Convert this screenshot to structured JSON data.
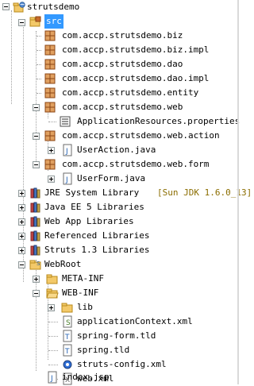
{
  "tree": {
    "project": "strutsdemo",
    "src": "src",
    "packages": [
      "com.accp.strutsdemo.biz",
      "com.accp.strutsdemo.biz.impl",
      "com.accp.strutsdemo.dao",
      "com.accp.strutsdemo.dao.impl",
      "com.accp.strutsdemo.entity",
      "com.accp.strutsdemo.web"
    ],
    "web_properties": "ApplicationResources.properties",
    "pkg_action": "com.accp.strutsdemo.web.action",
    "user_action": "UserAction.java",
    "pkg_form": "com.accp.strutsdemo.web.form",
    "user_form": "UserForm.java",
    "libraries": [
      {
        "name": "JRE System Library",
        "decor": "[Sun JDK 1.6.0_13]"
      },
      {
        "name": "Java EE 5 Libraries"
      },
      {
        "name": "Web App Libraries"
      },
      {
        "name": "Referenced Libraries"
      },
      {
        "name": "Struts 1.3 Libraries"
      }
    ],
    "webroot": "WebRoot",
    "meta_inf": "META-INF",
    "web_inf": "WEB-INF",
    "lib": "lib",
    "web_inf_files": [
      "applicationContext.xml",
      "spring-form.tld",
      "spring.tld",
      "struts-config.xml",
      "web.xml"
    ],
    "index": "index.jsp"
  },
  "colors": {
    "selection": "#3399ff",
    "decoration": "#8b6d00",
    "package_brown": "#b5651d",
    "folder_yellow": "#f3c969"
  },
  "icons": {
    "project": "web-project-icon",
    "src": "source-folder-icon",
    "package": "package-icon",
    "java": "java-file-icon",
    "library": "library-icon",
    "folder": "folder-icon",
    "xml": "xml-file-icon",
    "tld": "tld-file-icon",
    "gear": "gear-icon",
    "jsp": "jsp-file-icon"
  }
}
